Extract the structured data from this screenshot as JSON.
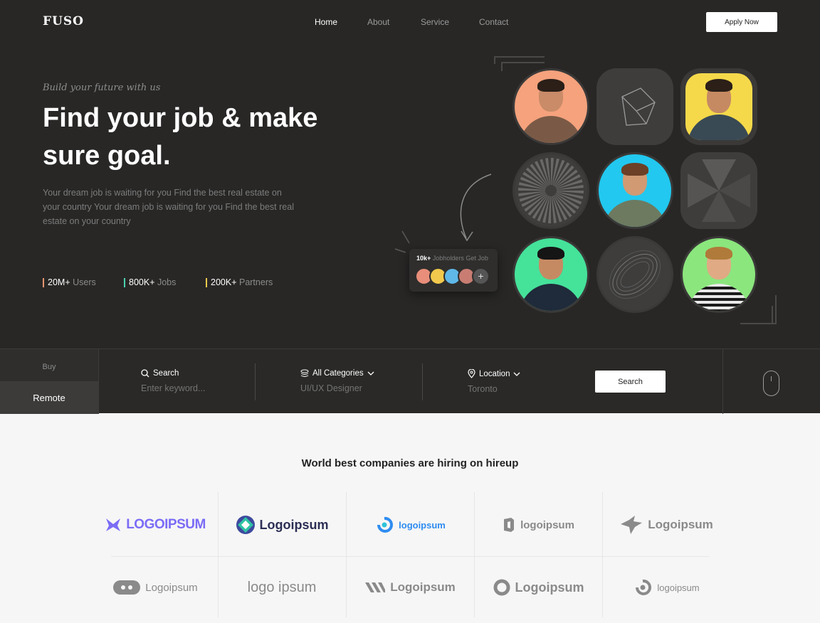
{
  "brand": {
    "logo": "FUSO"
  },
  "nav": {
    "items": [
      "Home",
      "About",
      "Service",
      "Contact"
    ],
    "active": "Home",
    "apply_label": "Apply Now"
  },
  "hero": {
    "tagline": "Build your future with us",
    "headline": "Find your job & make sure goal.",
    "description": "Your dream job is waiting for you Find the best real estate on your country Your dream job is waiting for you Find the best real estate on your country",
    "stats": [
      {
        "value": "20M+",
        "unit": "Users",
        "color": "#e8956e"
      },
      {
        "value": "800K+",
        "unit": "Jobs",
        "color": "#4cd3b0"
      },
      {
        "value": "200K+",
        "unit": "Partners",
        "color": "#f2c94c"
      }
    ],
    "jobholders": {
      "count": "10k+",
      "label": "Jobholders Get Job",
      "add_icon": "plus-icon"
    }
  },
  "search": {
    "tabs": {
      "buy": "Buy",
      "remote": "Remote"
    },
    "fields": [
      {
        "label": "Search",
        "value": "Enter keyword...",
        "icon": "search-icon"
      },
      {
        "label": "All Categories",
        "value": "UI/UX Designer",
        "icon": "layers-icon"
      },
      {
        "label": "Location",
        "value": "Toronto",
        "icon": "location-pin-icon"
      }
    ],
    "button": "Search"
  },
  "companies": {
    "title": "World best companies are hiring on hireup",
    "logos": [
      "LOGOIPSUM",
      "Logoipsum",
      "logoipsum",
      "logoipsum",
      "Logoipsum",
      "Logoipsum",
      "logo ipsum",
      "Logoipsum",
      "Logoipsum",
      "logoipsum"
    ]
  },
  "colors": {
    "dark_bg": "#282726",
    "accent_purple": "#7b6cf6",
    "accent_blue": "#2e8cf0",
    "accent_teal": "#2fc3d9"
  }
}
